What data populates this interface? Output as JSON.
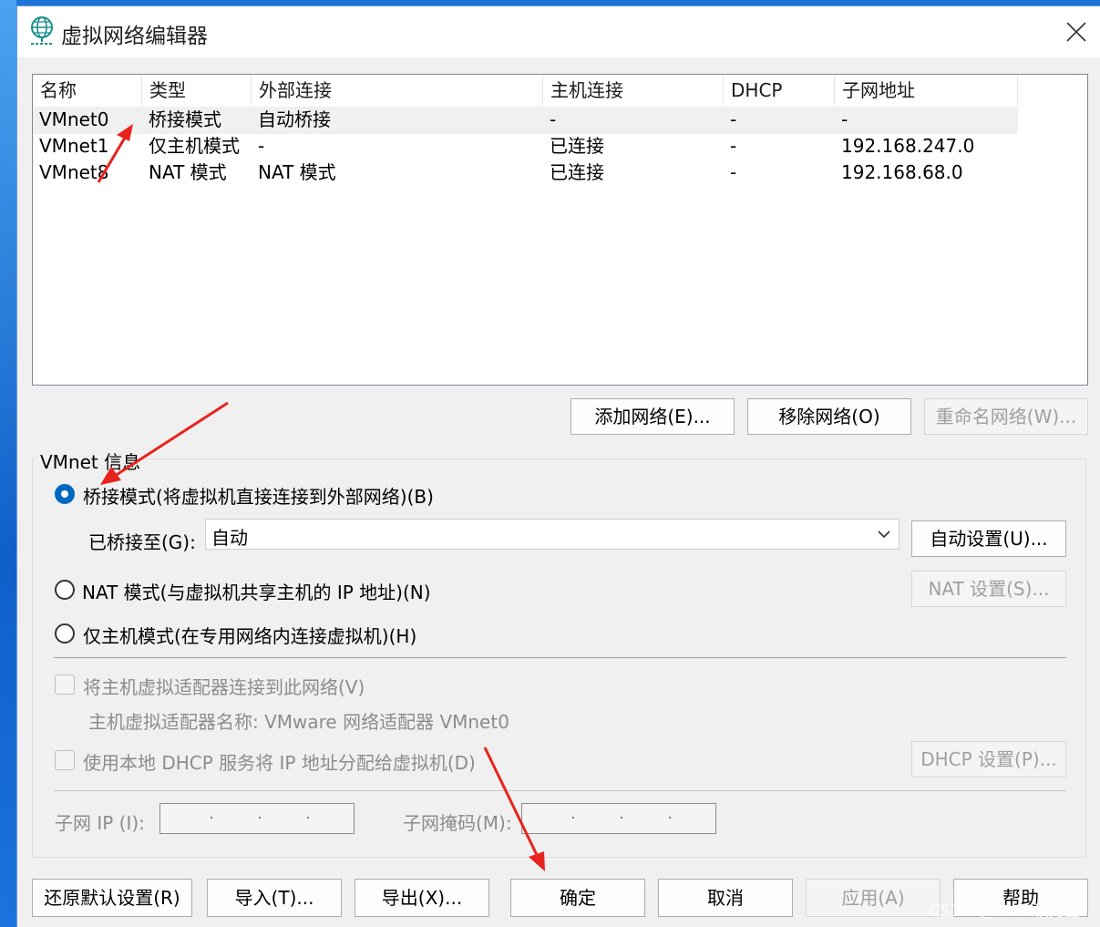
{
  "window": {
    "title": "虚拟网络编辑器",
    "icon": "globe-network-icon",
    "close_icon": "close-icon"
  },
  "network_list": {
    "columns": [
      "名称",
      "类型",
      "外部连接",
      "主机连接",
      "DHCP",
      "子网地址"
    ],
    "rows": [
      [
        "VMnet0",
        "桥接模式",
        "自动桥接",
        "-",
        "-",
        "-"
      ],
      [
        "VMnet1",
        "仅主机模式",
        "-",
        "已连接",
        "-",
        "192.168.247.0"
      ],
      [
        "VMnet8",
        "NAT 模式",
        "NAT 模式",
        "已连接",
        "-",
        "192.168.68.0"
      ]
    ],
    "selected_row": 0
  },
  "list_buttons": {
    "add": "添加网络(E)...",
    "remove": "移除网络(O)",
    "rename": "重命名网络(W)..."
  },
  "vmnet_info": {
    "group_title": "VMnet 信息",
    "bridged_label": "桥接模式(将虚拟机直接连接到外部网络)(B)",
    "bridged_to_label": "已桥接至(G):",
    "bridged_to_value": "自动",
    "auto_settings": "自动设置(U)...",
    "nat_label": "NAT 模式(与虚拟机共享主机的 IP 地址)(N)",
    "nat_settings": "NAT 设置(S)...",
    "host_only_label": "仅主机模式(在专用网络内连接虚拟机)(H)",
    "connect_adapter_label": "将主机虚拟适配器连接到此网络(V)",
    "adapter_name_label": "主机虚拟适配器名称: VMware 网络适配器 VMnet0",
    "dhcp_label": "使用本地 DHCP 服务将 IP 地址分配给虚拟机(D)",
    "dhcp_settings": "DHCP 设置(P)...",
    "subnet_ip_label": "子网 IP (I):",
    "subnet_mask_label": "子网掩码(M):"
  },
  "footer": {
    "restore": "还原默认设置(R)",
    "import": "导入(T)...",
    "export": "导出(X)...",
    "ok": "确定",
    "cancel": "取消",
    "apply": "应用(A)",
    "help": "帮助"
  },
  "watermark": "CSDN @1126秋刀鱼",
  "colors": {
    "accent": "#0067c0",
    "annotation_arrow": "#e8231d",
    "desktop": "#1e73d8"
  }
}
